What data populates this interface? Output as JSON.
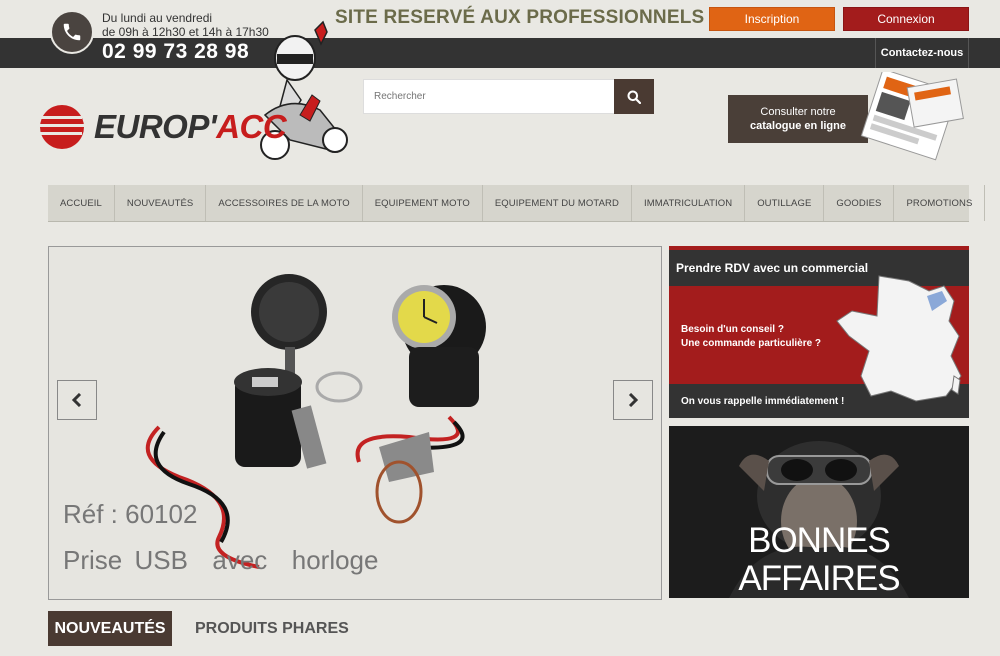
{
  "header": {
    "hours": [
      "Du lundi au vendredi",
      "de 09h à 12h30 et 14h à 17h30"
    ],
    "phone": "02 99 73 28 98",
    "pro_notice": "SITE RESERVÉ AUX PROFESSIONNELS",
    "inscription": "Inscription",
    "connexion": "Connexion",
    "contact": "Contactez-nous",
    "logo_left": "EUROP'",
    "logo_right": "ACC"
  },
  "search": {
    "placeholder": "Rechercher"
  },
  "catalogue": {
    "line1": "Consulter notre",
    "line2": "catalogue en ligne"
  },
  "nav": {
    "items": [
      "ACCUEIL",
      "NOUVEAUTÉS",
      "ACCESSOIRES DE LA MOTO",
      "EQUIPEMENT MOTO",
      "EQUIPEMENT DU MOTARD",
      "IMMATRICULATION",
      "OUTILLAGE",
      "GOODIES",
      "PROMOTIONS"
    ]
  },
  "slider": {
    "ref": "Réf : 60102",
    "name": "Prise USB  avec  horloge"
  },
  "rdv": {
    "title": "Prendre RDV avec un commercial",
    "q1": "Besoin d'un conseil ?",
    "q2": "Une commande particulière ?",
    "call": "On vous rappelle immédiatement !"
  },
  "bonnes_affaires": "BONNES AFFAIRES",
  "tabs": {
    "active": "NOUVEAUTÉS",
    "other": "PRODUITS PHARES"
  },
  "colors": {
    "accent_orange": "#e06414",
    "accent_red": "#a31c1c",
    "dark_brown": "#4a3a32",
    "dark_bar": "#333333"
  },
  "icons": {
    "phone": "phone-icon",
    "search": "search-icon",
    "prev": "chevron-left-icon",
    "next": "chevron-right-icon"
  }
}
